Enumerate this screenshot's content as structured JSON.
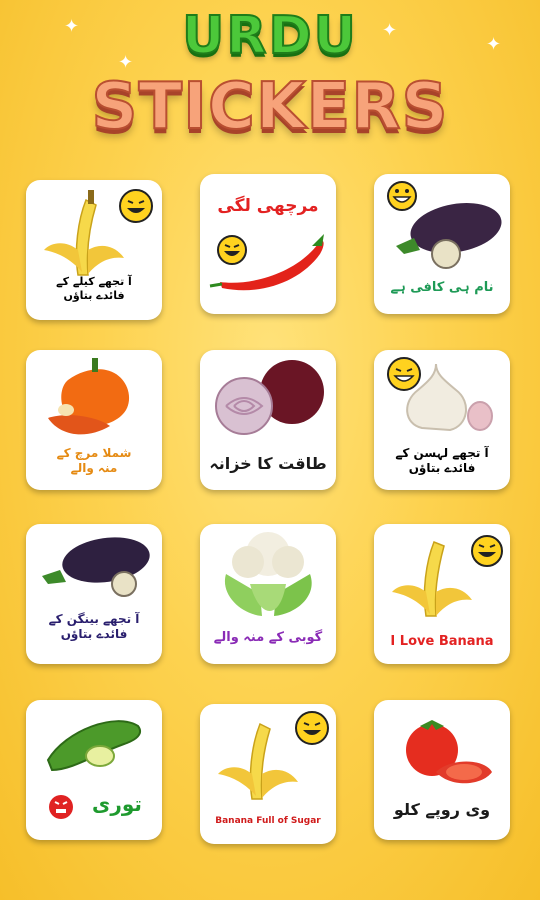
{
  "header": {
    "line1": "URDU",
    "line2": "STICKERS"
  },
  "stickers": [
    {
      "caption": "آ تجھے کیلے کے\nفائدے بتاؤں",
      "color": "#1a1a1a",
      "item": "banana-icon"
    },
    {
      "caption": "مرچھی لگی",
      "color": "#e32222",
      "item": "chili-icon"
    },
    {
      "caption": "نام ہی کافی ہے",
      "color": "#1e9a56",
      "item": "eggplant-icon"
    },
    {
      "caption": "شملا مرچ کے\nمنہ والے",
      "color": "#e58a12",
      "item": "bell-pepper-icon"
    },
    {
      "caption": "طاقت کا خزانہ",
      "color": "#1a1a1a",
      "item": "onion-icon"
    },
    {
      "caption": "آ تجھے لہسن کے\nفائدے بتاؤں",
      "color": "#1a1a1a",
      "item": "garlic-icon"
    },
    {
      "caption": "آ تجھے بینگن کے\nفائدے بتاؤں",
      "color": "#1a1a1a",
      "item": "eggplant-icon"
    },
    {
      "caption": "گوبی کے منہ والے",
      "color": "#8a2bb6",
      "item": "cauliflower-icon"
    },
    {
      "caption": "I Love Banana",
      "color": "#e32222",
      "item": "banana-icon"
    },
    {
      "caption": "توری",
      "color": "#1e9a2e",
      "item": "zucchini-icon"
    },
    {
      "caption": "Banana Full of Sugar",
      "color": "#d01b1b",
      "item": "banana-icon"
    },
    {
      "caption": "وی روپے کلو",
      "color": "#1a1a1a",
      "item": "tomato-icon"
    }
  ]
}
